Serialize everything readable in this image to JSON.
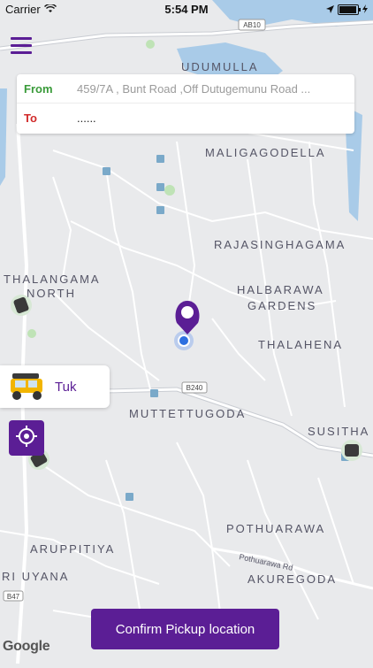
{
  "status_bar": {
    "carrier": "Carrier",
    "time": "5:54 PM",
    "battery_level": 0.85
  },
  "address_panel": {
    "from_label": "From",
    "from_value": "459/7A , Bunt Road ,Off Dutugemunu Road ...",
    "to_label": "To",
    "to_value": "......"
  },
  "vehicle": {
    "label": "Tuk"
  },
  "map_labels": {
    "ab10": "AB10",
    "udumulla": "UDUMULLA",
    "maligagodella": "MALIGAGODELLA",
    "rajasinghagama": "RAJASINGHAGAMA",
    "thalangama_north_1": "THALANGAMA",
    "thalangama_north_2": "NORTH",
    "halbarawa_1": "HALBARAWA",
    "halbarawa_2": "GARDENS",
    "thalahena": "THALAHENA",
    "b240": "B240",
    "muttettugoda": "MUTTETTUGODA",
    "susitha": "SUSITHA P",
    "pothuarawa": "POTHUARAWA",
    "aruppitiya": "ARUPPITIYA",
    "pothuarawa_rd": "Pothuarawa Rd",
    "ri_uyana": "RI UYANA",
    "akuregoda": "AKUREGODA",
    "b47": "B47"
  },
  "confirm_button": {
    "label": "Confirm Pickup location"
  },
  "map_attribution": "Google",
  "colors": {
    "brand": "#5b1e95",
    "from": "#3a9b3a",
    "to": "#d12a2a",
    "map_bg": "#e9eaec",
    "road": "#ffffff",
    "water": "#a9cbe8"
  }
}
